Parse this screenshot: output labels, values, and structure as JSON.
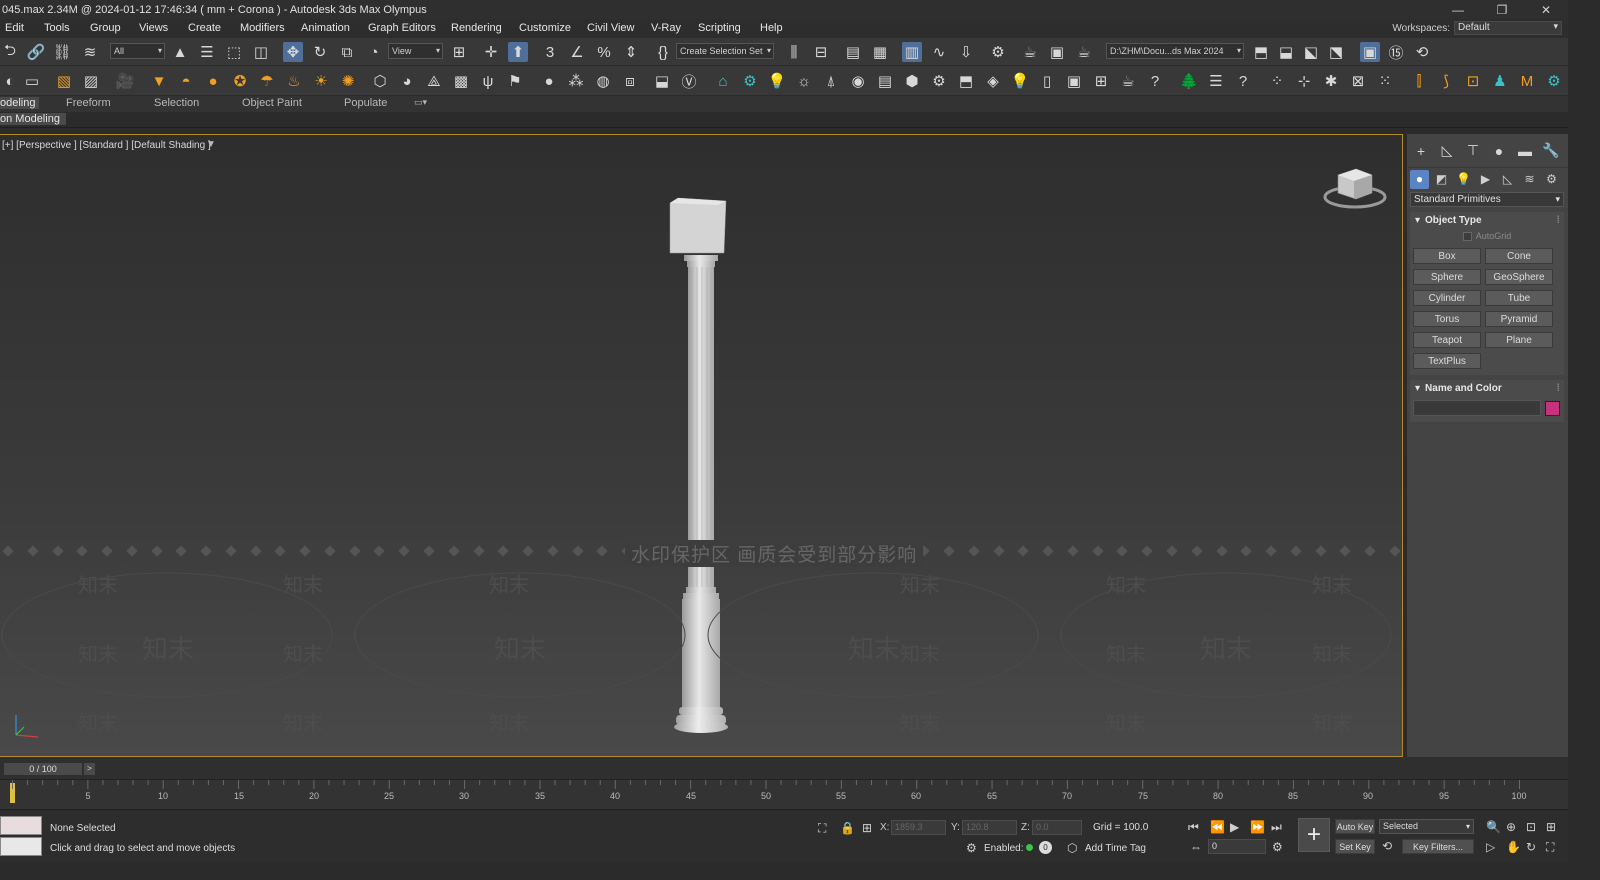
{
  "window": {
    "title": "045.max  2.34M @ 2024-01-12 17:46:34  ( mm + Corona ) - Autodesk 3ds Max Olympus",
    "minimize": "—",
    "maximize": "❐",
    "close": "✕"
  },
  "menu": {
    "items": [
      "Edit",
      "Tools",
      "Group",
      "Views",
      "Create",
      "Modifiers",
      "Animation",
      "Graph Editors",
      "Rendering",
      "Customize",
      "Civil View",
      "V-Ray",
      "Scripting",
      "Help"
    ],
    "workspaces_label": "Workspaces:",
    "workspaces_value": "Default"
  },
  "toolbar": {
    "selection_filter": "All",
    "ref_coord": "View",
    "named_selection": "Create Selection Set",
    "project_path": "D:\\ZHM\\Docu...ds Max 2024"
  },
  "ribbon": {
    "tabs": [
      "odeling",
      "Freeform",
      "Selection",
      "Object Paint",
      "Populate"
    ],
    "sub_label": "on Modeling"
  },
  "viewport": {
    "label": "[+] [Perspective ] [Standard ] [Default Shading ]",
    "watermark_text": "水印保护区   画质会受到部分影响",
    "watermark_tile": "知末"
  },
  "command_panel": {
    "category": "Standard Primitives",
    "object_type_title": "Object Type",
    "autogrid": "AutoGrid",
    "primitives": [
      "Box",
      "Cone",
      "Sphere",
      "GeoSphere",
      "Cylinder",
      "Tube",
      "Torus",
      "Pyramid",
      "Teapot",
      "Plane",
      "TextPlus"
    ],
    "name_color_title": "Name and Color",
    "object_color": "#c8327c"
  },
  "timeline": {
    "slider": "0 / 100",
    "next": ">",
    "ticks": [
      "5",
      "10",
      "15",
      "20",
      "25",
      "30",
      "35",
      "40",
      "45",
      "50",
      "55",
      "60",
      "65",
      "70",
      "75",
      "80",
      "85",
      "90",
      "95",
      "100"
    ]
  },
  "status": {
    "selection": "None Selected",
    "prompt": "Click and drag to select and move objects",
    "x_label": "X:",
    "x_value": "1859.3",
    "y_label": "Y:",
    "y_value": "120.8",
    "z_label": "Z:",
    "z_value": "0.0",
    "grid": "Grid = 100.0",
    "enabled": "Enabled:",
    "enabled_count": "0",
    "add_time_tag": "Add Time Tag",
    "frame": "0",
    "auto_key": "Auto Key",
    "set_key": "Set Key",
    "key_mode": "Selected",
    "key_filters": "Key Filters..."
  }
}
